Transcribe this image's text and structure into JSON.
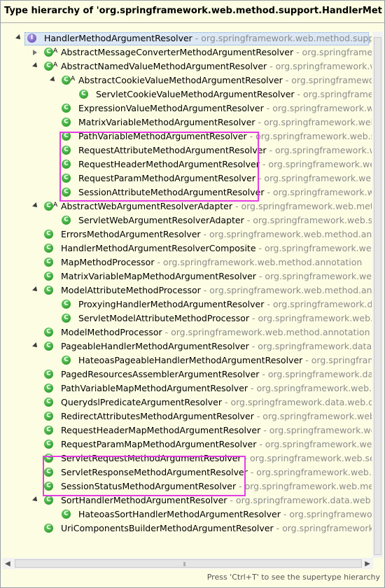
{
  "window": {
    "title": "Type hierarchy of 'org.springframework.web.method.support.HandlerMethodArgun"
  },
  "tree": {
    "rows": [
      {
        "name": "HandlerMethodArgumentResolver",
        "pkg": " - org.springframework.web.method.support",
        "icon": "interface-icon",
        "expanded": true,
        "depth": 0,
        "selected": true
      },
      {
        "name": "AbstractMessageConverterMethodArgumentResolver",
        "pkg": " - org.springframework.web.m",
        "icon": "abstract-class-icon",
        "collapsed": true,
        "depth": 1
      },
      {
        "name": "AbstractNamedValueMethodArgumentResolver",
        "pkg": " - org.springframework.web.meth",
        "icon": "abstract-class-icon",
        "expanded": true,
        "depth": 1
      },
      {
        "name": "AbstractCookieValueMethodArgumentResolver",
        "pkg": " - org.springframework.web.b",
        "icon": "abstract-class-icon",
        "expanded": true,
        "depth": 2
      },
      {
        "name": "ServletCookieValueMethodArgumentResolver",
        "pkg": " - org.springframework.we",
        "icon": "class-icon",
        "depth": 3
      },
      {
        "name": "ExpressionValueMethodArgumentResolver",
        "pkg": " - org.springframework.web.meth",
        "icon": "class-icon",
        "depth": 2
      },
      {
        "name": "MatrixVariableMethodArgumentResolver",
        "pkg": " - org.springframework.web.servl",
        "icon": "class-icon",
        "depth": 2
      },
      {
        "name": "PathVariableMethodArgumentResolver",
        "pkg": " - org.springframework.web.servlet",
        "icon": "class-icon",
        "depth": 2
      },
      {
        "name": "RequestAttributeMethodArgumentResolver",
        "pkg": " - org.springframework.web.se",
        "icon": "class-icon",
        "depth": 2
      },
      {
        "name": "RequestHeaderMethodArgumentResolver",
        "pkg": " - org.springframework.web.met",
        "icon": "class-icon",
        "depth": 2
      },
      {
        "name": "RequestParamMethodArgumentResolver",
        "pkg": " - org.springframework.web.meth",
        "icon": "class-icon",
        "depth": 2
      },
      {
        "name": "SessionAttributeMethodArgumentResolver",
        "pkg": " - org.springframework.web.se",
        "icon": "class-icon",
        "depth": 2
      },
      {
        "name": "AbstractWebArgumentResolverAdapter",
        "pkg": " - org.springframework.web.method.an",
        "icon": "abstract-class-icon",
        "expanded": true,
        "depth": 1
      },
      {
        "name": "ServletWebArgumentResolverAdapter",
        "pkg": " - org.springframework.web.servlet.r",
        "icon": "class-icon",
        "depth": 2
      },
      {
        "name": "ErrorsMethodArgumentResolver",
        "pkg": " - org.springframework.web.method.annotatio",
        "icon": "class-icon",
        "depth": 1
      },
      {
        "name": "HandlerMethodArgumentResolverComposite",
        "pkg": " - org.springframework.web.meth",
        "icon": "class-icon",
        "depth": 1
      },
      {
        "name": "MapMethodProcessor",
        "pkg": " - org.springframework.web.method.annotation",
        "icon": "class-icon",
        "depth": 1
      },
      {
        "name": "MatrixVariableMapMethodArgumentResolver",
        "pkg": " - org.springframework.web.servle",
        "icon": "class-icon",
        "depth": 1
      },
      {
        "name": "ModelAttributeMethodProcessor",
        "pkg": " - org.springframework.web.method.annotatio",
        "icon": "class-icon",
        "expanded": true,
        "depth": 1
      },
      {
        "name": "ProxyingHandlerMethodArgumentResolver",
        "pkg": " - org.springframework.data.wel",
        "icon": "class-icon",
        "depth": 2
      },
      {
        "name": "ServletModelAttributeMethodProcessor",
        "pkg": " - org.springframework.web.servle",
        "icon": "class-icon",
        "depth": 2
      },
      {
        "name": "ModelMethodProcessor",
        "pkg": " - org.springframework.web.method.annotation",
        "icon": "class-icon",
        "depth": 1
      },
      {
        "name": "PageableHandlerMethodArgumentResolver",
        "pkg": " - org.springframework.data.web",
        "icon": "class-icon",
        "expanded": true,
        "depth": 1
      },
      {
        "name": "HateoasPageableHandlerMethodArgumentResolver",
        "pkg": " - org.springframework.d",
        "icon": "class-icon",
        "depth": 2
      },
      {
        "name": "PagedResourcesAssemblerArgumentResolver",
        "pkg": " - org.springframework.data.web",
        "icon": "class-icon",
        "depth": 1
      },
      {
        "name": "PathVariableMapMethodArgumentResolver",
        "pkg": " - org.springframework.web.servlet",
        "icon": "class-icon",
        "depth": 1
      },
      {
        "name": "QuerydslPredicateArgumentResolver",
        "pkg": " - org.springframework.data.web.querydsl",
        "icon": "class-icon",
        "depth": 1
      },
      {
        "name": "RedirectAttributesMethodArgumentResolver",
        "pkg": " - org.springframework.web.servle",
        "icon": "class-icon",
        "depth": 1
      },
      {
        "name": "RequestHeaderMapMethodArgumentResolver",
        "pkg": " - org.springframework.web.met",
        "icon": "class-icon",
        "depth": 1
      },
      {
        "name": "RequestParamMapMethodArgumentResolver",
        "pkg": " - org.springframework.web.meth",
        "icon": "class-icon",
        "depth": 1
      },
      {
        "name": "ServletRequestMethodArgumentResolver",
        "pkg": " - org.springframework.web.servlet.m",
        "icon": "class-icon",
        "depth": 1
      },
      {
        "name": "ServletResponseMethodArgumentResolver",
        "pkg": " - org.springframework.web.servlet.r",
        "icon": "class-icon",
        "depth": 1
      },
      {
        "name": "SessionStatusMethodArgumentResolver",
        "pkg": " - org.springframework.web.method.an",
        "icon": "class-icon",
        "depth": 1
      },
      {
        "name": "SortHandlerMethodArgumentResolver",
        "pkg": " - org.springframework.data.web",
        "icon": "class-icon",
        "expanded": true,
        "depth": 1
      },
      {
        "name": "HateoasSortHandlerMethodArgumentResolver",
        "pkg": " - org.springframework.data.w",
        "icon": "class-icon",
        "depth": 2
      },
      {
        "name": "UriComponentsBuilderMethodArgumentResolver",
        "pkg": " - org.springframework.web.m",
        "icon": "class-icon",
        "depth": 1
      }
    ]
  },
  "status": {
    "hint": "Press 'Ctrl+T' to see the supertype hierarchy"
  },
  "colors": {
    "highlight_box": "#e43ee4",
    "background": "#fdfde4",
    "package_text": "#8b8b8b"
  }
}
